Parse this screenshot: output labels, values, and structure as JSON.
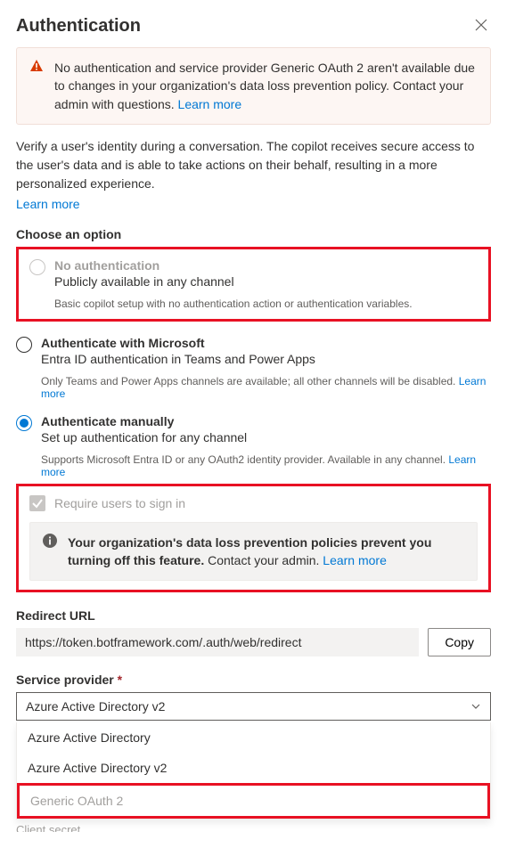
{
  "header": {
    "title": "Authentication"
  },
  "alert": {
    "text": "No authentication and service provider Generic OAuth 2 aren't available due to changes in your organization's data loss prevention policy. Contact your admin with questions. ",
    "link": "Learn more"
  },
  "description": {
    "text": "Verify a user's identity during a conversation. The copilot receives secure access to the user's data and is able to take actions on their behalf, resulting in a more personalized experience.",
    "link": "Learn more"
  },
  "choose_label": "Choose an option",
  "options": {
    "none": {
      "title": "No authentication",
      "sub": "Publicly available in any channel",
      "note": "Basic copilot setup with no authentication action or authentication variables."
    },
    "ms": {
      "title": "Authenticate with Microsoft",
      "sub": "Entra ID authentication in Teams and Power Apps",
      "note": "Only Teams and Power Apps channels are available; all other channels will be disabled. ",
      "note_link": "Learn more"
    },
    "manual": {
      "title": "Authenticate manually",
      "sub": "Set up authentication for any channel",
      "note": "Supports Microsoft Entra ID or any OAuth2 identity provider. Available in any channel. ",
      "note_link": "Learn more"
    }
  },
  "require_signin": {
    "label": "Require users to sign in",
    "info_bold": "Your organization's data loss prevention policies prevent you turning off this feature.",
    "info_rest": " Contact your admin. ",
    "info_link": "Learn more"
  },
  "redirect": {
    "label": "Redirect URL",
    "value": "https://token.botframework.com/.auth/web/redirect",
    "copy": "Copy"
  },
  "provider": {
    "label": "Service provider ",
    "selected": "Azure Active Directory v2",
    "options": [
      "Azure Active Directory",
      "Azure Active Directory v2",
      "Generic OAuth 2"
    ]
  },
  "cutoff": "Client secret"
}
